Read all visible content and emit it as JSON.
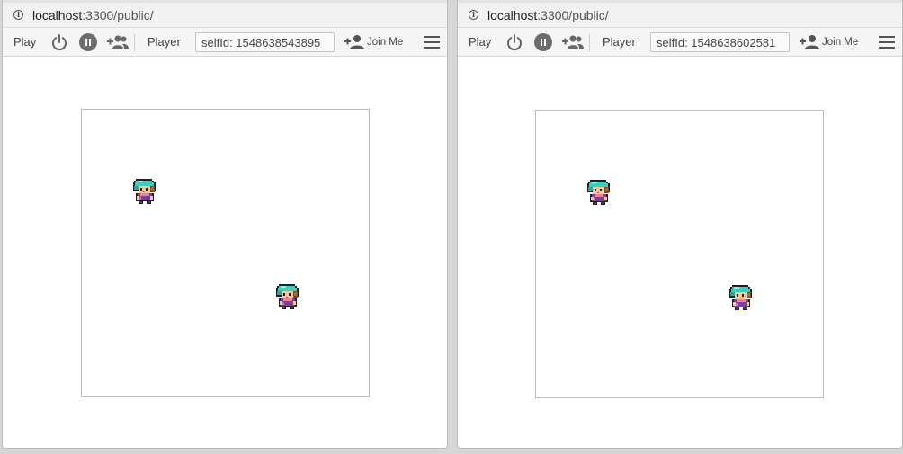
{
  "windows": [
    {
      "url_host": "localhost",
      "url_path": ":3300/public/",
      "toolbar": {
        "play_label": "Play",
        "player_label": "Player",
        "self_id": "selfId: 1548638543895",
        "join_label": "Join Me"
      },
      "canvas": {
        "player_count": 2
      }
    },
    {
      "url_host": "localhost",
      "url_path": ":3300/public/",
      "toolbar": {
        "play_label": "Play",
        "player_label": "Player",
        "self_id": "selfId: 1548638602581",
        "join_label": "Join Me"
      },
      "canvas": {
        "player_count": 2
      }
    }
  ],
  "icons": {
    "info": "info-icon",
    "power": "power-icon",
    "pause": "pause-icon",
    "group_add": "group-add-icon",
    "person_add": "person-add-icon",
    "menu": "menu-icon"
  },
  "colors": {
    "toolbar_bg": "#f5f5f5",
    "urlbar_bg": "#f2f2f2",
    "sprite_hair": "#3ecdb8",
    "sprite_outfit": "#7b3fa0"
  }
}
